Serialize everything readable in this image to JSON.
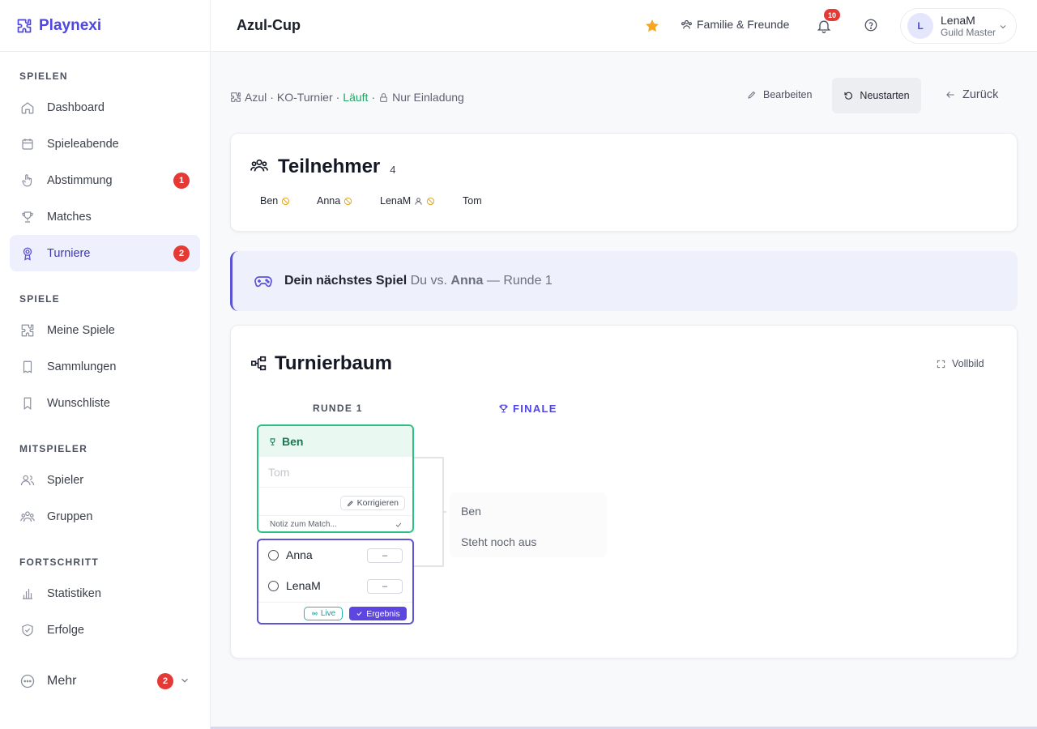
{
  "brand": {
    "name": "Playnexi"
  },
  "sidebar": {
    "sections": [
      {
        "title": "SPIELEN"
      },
      {
        "title": "SPIELE"
      },
      {
        "title": "MITSPIELER"
      },
      {
        "title": "FORTSCHRITT"
      }
    ],
    "items": [
      {
        "label": "Dashboard",
        "icon": "home-icon"
      },
      {
        "label": "Spieleabende",
        "icon": "calendar-icon"
      },
      {
        "label": "Abstimmung",
        "icon": "hand-pointer-icon",
        "badge": "1"
      },
      {
        "label": "Matches",
        "icon": "trophy-icon"
      },
      {
        "label": "Turniere",
        "icon": "award-icon",
        "badge": "2",
        "active": true
      },
      {
        "label": "Meine Spiele",
        "icon": "puzzle-icon"
      },
      {
        "label": "Sammlungen",
        "icon": "book-icon"
      },
      {
        "label": "Wunschliste",
        "icon": "bookmark-icon"
      },
      {
        "label": "Spieler",
        "icon": "users-icon"
      },
      {
        "label": "Gruppen",
        "icon": "group-icon"
      },
      {
        "label": "Statistiken",
        "icon": "bar-chart-icon"
      },
      {
        "label": "Erfolge",
        "icon": "shield-check-icon"
      }
    ],
    "more": {
      "label": "Mehr",
      "badge": "2"
    }
  },
  "header": {
    "title": "Azul-Cup",
    "group_label": "Familie & Freunde",
    "notifications_count": "10",
    "user": {
      "initial": "L",
      "name": "LenaM",
      "role": "Guild Master"
    }
  },
  "meta": {
    "game": "Azul",
    "sep1": "·",
    "format": "KO-Turnier",
    "sep2": "·",
    "status": "Läuft",
    "sep3": "·",
    "access": "Nur Einladung"
  },
  "actions": {
    "edit": "Bearbeiten",
    "restart": "Neustarten",
    "back": "Zurück"
  },
  "participants": {
    "title": "Teilnehmer",
    "count": "4",
    "list": [
      {
        "name": "Ben"
      },
      {
        "name": "Anna"
      },
      {
        "name": "LenaM"
      },
      {
        "name": "Tom"
      }
    ]
  },
  "next_game": {
    "label": "Dein nächstes Spiel",
    "you": "Du vs.",
    "opponent": "Anna",
    "round": "— Runde 1"
  },
  "bracket": {
    "title": "Turnierbaum",
    "fullscreen": "Vollbild",
    "round1_label": "RUNDE 1",
    "final_label": "FINALE",
    "match1": {
      "winner": "Ben",
      "loser": "Tom",
      "correct_label": "Korrigieren",
      "note_placeholder": "Notiz zum Match..."
    },
    "match2": {
      "player_a": "Anna",
      "player_b": "LenaM",
      "score_a": "–",
      "score_b": "–",
      "live_label": "Live",
      "result_label": "Ergebnis"
    },
    "final": {
      "player_a": "Ben",
      "player_b": "Steht noch aus"
    }
  },
  "colors": {
    "accent": "#4f46e5",
    "success": "#22a565",
    "danger": "#e53935",
    "star": "#f5a623"
  }
}
